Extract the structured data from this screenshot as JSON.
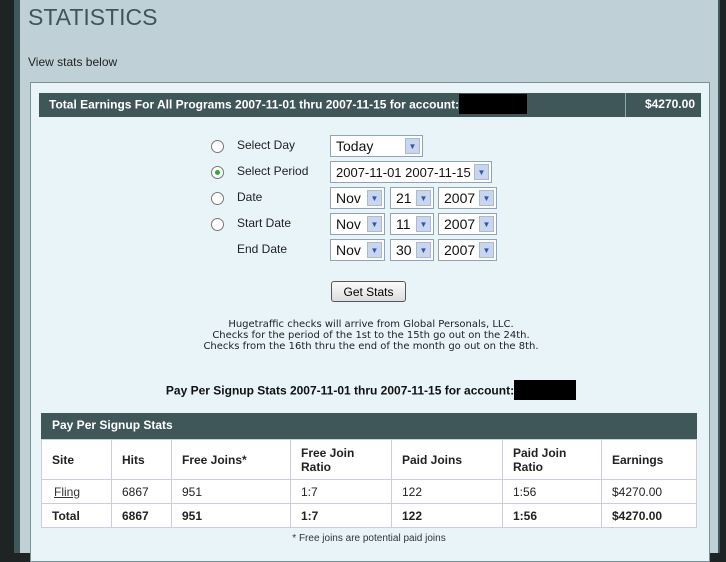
{
  "page": {
    "title": "STATISTICS",
    "subtitle": "View stats below"
  },
  "summary": {
    "label": "Total Earnings For All Programs 2007-11-01 thru 2007-11-15 for account:",
    "amount": "$4270.00"
  },
  "form": {
    "select_day": {
      "label": "Select Day",
      "value": "Today"
    },
    "select_period": {
      "label": "Select Period",
      "value": "2007-11-01 2007-11-15"
    },
    "date": {
      "label": "Date",
      "month": "Nov",
      "day": "21",
      "year": "2007"
    },
    "start_date": {
      "label": "Start Date",
      "month": "Nov",
      "day": "11",
      "year": "2007"
    },
    "end_date": {
      "label": "End Date",
      "month": "Nov",
      "day": "30",
      "year": "2007"
    },
    "submit": "Get Stats"
  },
  "notes": [
    "Hugetraffic checks will arrive from Global Personals, LLC.",
    "Checks for the period of the 1st to the 15th go out on the 24th.",
    "Checks from the 16th thru the end of the month go out on the 8th."
  ],
  "pps": {
    "title": "Pay Per Signup Stats 2007-11-01 thru 2007-11-15 for account:",
    "table_title": "Pay Per Signup Stats",
    "columns": [
      "Site",
      "Hits",
      "Free Joins*",
      "Free Join Ratio",
      "Paid Joins",
      "Paid Join Ratio",
      "Earnings"
    ],
    "rows": [
      [
        "Fling",
        "6867",
        "951",
        "1:7",
        "122",
        "1:56",
        "$4270.00"
      ]
    ],
    "total": [
      "Total",
      "6867",
      "951",
      "1:7",
      "122",
      "1:56",
      "$4270.00"
    ],
    "footnote": "* Free joins are potential paid joins"
  }
}
